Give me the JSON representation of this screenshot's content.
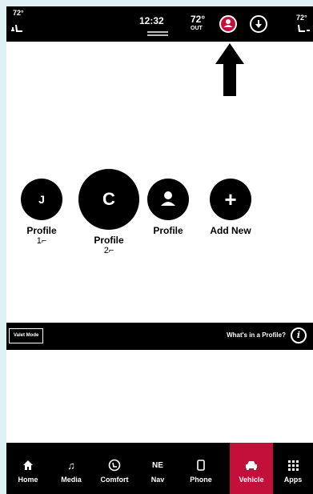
{
  "status_bar": {
    "left_temp": "72°",
    "time": "12:32",
    "outside_temp": "72°",
    "outside_label": "OUT",
    "right_temp": "72°"
  },
  "profiles": [
    {
      "initial": "J",
      "label": "Profile",
      "sub": "1"
    },
    {
      "initial": "C",
      "label": "Profile",
      "sub": "2"
    },
    {
      "initial": "",
      "label": "Profile",
      "sub": ""
    },
    {
      "initial": "+",
      "label": "Add New",
      "sub": ""
    }
  ],
  "mid_bar": {
    "valet_label": "Valet Mode",
    "whats_label": "What's in a Profile?",
    "info_glyph": "i"
  },
  "nav": [
    {
      "label": "Home",
      "icon": "home-icon"
    },
    {
      "label": "Media",
      "icon": "music-icon"
    },
    {
      "label": "Comfort",
      "icon": "comfort-icon"
    },
    {
      "label": "Nav",
      "icon": "compass-icon",
      "glyph": "NE"
    },
    {
      "label": "Phone",
      "icon": "phone-icon"
    },
    {
      "label": "Vehicle",
      "icon": "car-icon",
      "active": true
    },
    {
      "label": "Apps",
      "icon": "grid-icon"
    }
  ],
  "colors": {
    "accent": "#c2103a",
    "bar": "#000000",
    "background": "#ffffff"
  }
}
